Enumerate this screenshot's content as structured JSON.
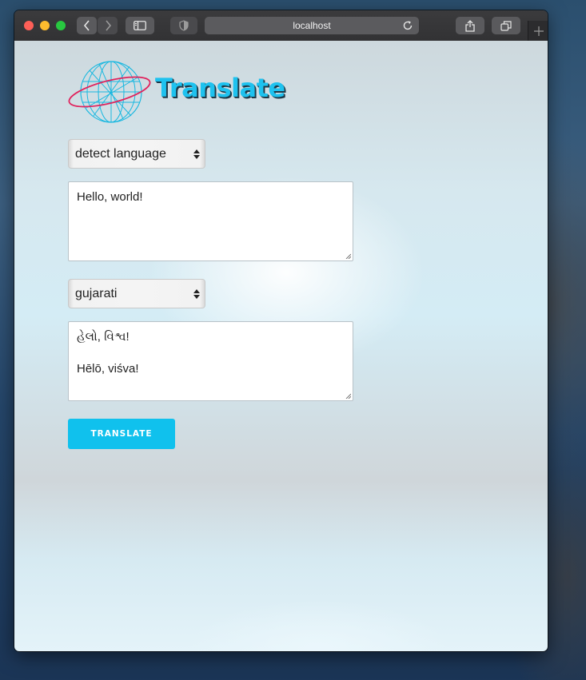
{
  "browser": {
    "url": "localhost"
  },
  "app": {
    "title": "Translate"
  },
  "source": {
    "language": "detect language",
    "text": "Hello, world!"
  },
  "target": {
    "language": "gujarati",
    "native": "હેલો, વિશ્વ!",
    "romanized": "Hēlō, viśva!"
  },
  "actions": {
    "translate_label": "TRANSLATE"
  },
  "colors": {
    "accent": "#10c1ed",
    "logo_text": "#1ec2ef",
    "logo_ring": "#e0245e"
  }
}
